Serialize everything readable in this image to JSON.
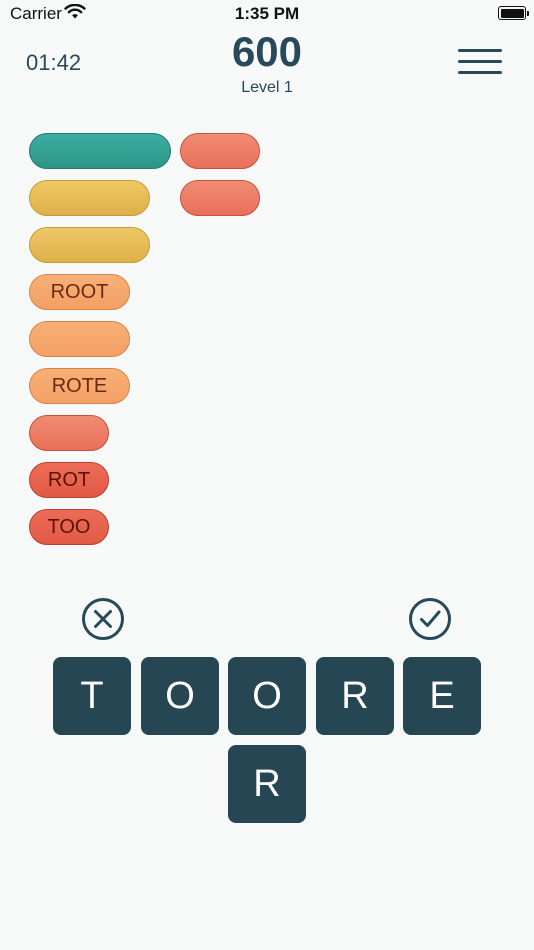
{
  "status": {
    "carrier": "Carrier",
    "time": "1:35 PM"
  },
  "header": {
    "timer": "01:42",
    "score": "600",
    "level": "Level 1"
  },
  "words": [
    {
      "text": "",
      "color": "teal"
    },
    {
      "text": "",
      "color": "salmon"
    },
    {
      "text": "",
      "color": "yellow"
    },
    {
      "text": "",
      "color": "salmon"
    },
    {
      "text": "",
      "color": "yellow"
    },
    {
      "text": "ROOT",
      "color": "orange"
    },
    {
      "text": "",
      "color": "orange"
    },
    {
      "text": "ROTE",
      "color": "orange"
    },
    {
      "text": "",
      "color": "salmon"
    },
    {
      "text": "ROT",
      "color": "red"
    },
    {
      "text": "TOO",
      "color": "red"
    }
  ],
  "tiles": [
    "T",
    "O",
    "O",
    "R",
    "E",
    "R"
  ],
  "colors": {
    "primary": "#27495a",
    "tile": "#264654",
    "background": "#f7f9f9"
  }
}
